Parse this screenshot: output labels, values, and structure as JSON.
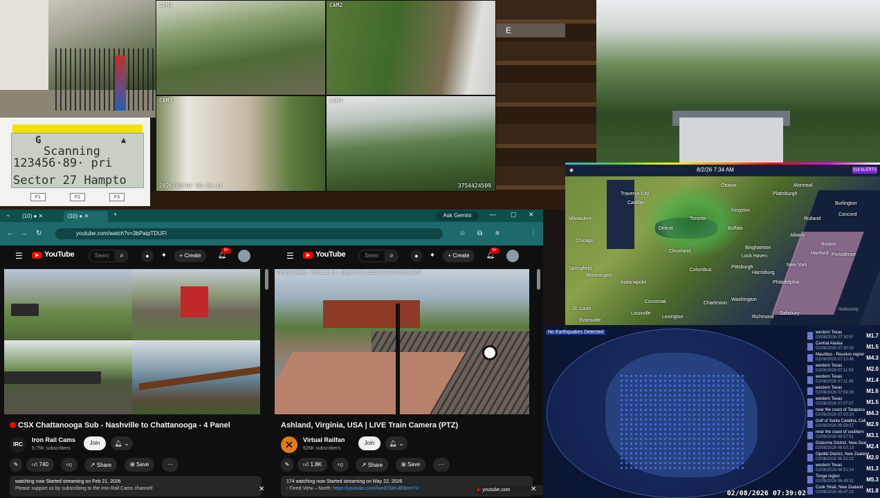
{
  "cameras": {
    "cam1_label": "CAM1",
    "cam2_label": "CAM2",
    "cam3_label": "CAM3",
    "cam4_label": "CAM4",
    "timestamp": "2026/08/02 06:36:11",
    "cam4_id": "3754424509"
  },
  "game": {
    "hud_letter": "E"
  },
  "scanner": {
    "line1_left": "G",
    "line1_right": "▲",
    "line2": "Scanning",
    "line3": "123456·89·  pri",
    "line4": "Sector 27 Hampto",
    "f1": "F1",
    "f2": "F2",
    "f3": "F3"
  },
  "browser": {
    "tab1": "(10) ●",
    "tab2": "(10) ●",
    "ask_gemini": "Ask Gemini",
    "url": "youtube.com/watch?v=3bPatpTDUFI",
    "new_tab": "+"
  },
  "youtube_left": {
    "logo": "YouTube",
    "search_placeholder": "Searc",
    "create": "Create",
    "badge": "9+",
    "title": "CSX Chattanooga Sub - Nashville to Chattanooga - 4 Panel",
    "channel": "Iron Rail Cams",
    "subscribers": "5.75K subscribers",
    "join": "Join",
    "likes": "740",
    "share": "Share",
    "save": "Save",
    "desc_line1": "watching now  Started streaming on Feb 21, 2026",
    "desc_line2": "Please support us by subscribing to the Iron Rail Cams channel!",
    "chav_text": "IRC"
  },
  "youtube_right": {
    "logo": "YouTube",
    "search_placeholder": "Searc",
    "create": "Create",
    "badge": "9+",
    "overlay": "Virtual Railfan - Ashland, Va - Depot PTZ  2026-08-02 07:36:20 EDT",
    "title": "Ashland, Virginia, USA | LIVE Train Camera (PTZ)",
    "channel": "Virtual Railfan",
    "subscribers": "526K subscribers",
    "join": "Join",
    "likes": "1.8K",
    "share": "Share",
    "save": "Save",
    "desc_line1": "174 watching now  Started streaming on May 22, 2026",
    "desc_line2_prefix": "- Fixed View – North: ",
    "desc_link": "https://youtube.com/live/DSkKdEBmrYU",
    "notif": "youtube.com"
  },
  "weather": {
    "time": "8/2/26 7:34 AM",
    "alerts": "318 ALERTS",
    "footer": "Reflectivity",
    "cities": [
      "Traverse City",
      "Ottawa",
      "Montreal",
      "Plattsburgh",
      "Cadillac",
      "Burlington",
      "Kingston",
      "Milwaukee",
      "Toronto",
      "Rutland",
      "Concord",
      "Chicago",
      "Detroit",
      "Buffalo",
      "Albany",
      "Boston",
      "Cleveland",
      "Binghamton",
      "Hartford",
      "Providence",
      "Springfield",
      "Indianapolis",
      "Columbus",
      "Pittsburgh",
      "Philadelphia",
      "New York",
      "Lock Haven",
      "Harrisburg",
      "Bloomington",
      "Cincinnati",
      "Washington",
      "Louisville",
      "Lexington",
      "Charleston",
      "St. Louis",
      "Evansville",
      "Richmond",
      "Salisbury"
    ]
  },
  "earthquakes": {
    "title": "No Earthquakes Detected",
    "time": "02/08/2026 07:39:02",
    "list": [
      {
        "place": "western Texas",
        "date": "02/08/2026 07:30:57",
        "mag": "M1.7"
      },
      {
        "place": "Central Alaska",
        "date": "02/08/2026 07:30:33",
        "mag": "M1.5"
      },
      {
        "place": "Mauritius - Reunion region",
        "date": "02/08/2026 07:12:46",
        "mag": "M4.3"
      },
      {
        "place": "western Texas",
        "date": "02/08/2026 07:11:59",
        "mag": "M2.0"
      },
      {
        "place": "western Texas",
        "date": "02/08/2026 07:11:49",
        "mag": "M1.4"
      },
      {
        "place": "western Texas",
        "date": "02/08/2026 07:09:26",
        "mag": "M1.6"
      },
      {
        "place": "western Texas",
        "date": "02/08/2026 07:07:07",
        "mag": "M1.5"
      },
      {
        "place": "near the coast of Tarapaca",
        "date": "02/08/2026 07:03:20",
        "mag": "M4.3"
      },
      {
        "place": "Gulf of Santa Catalina, Cali",
        "date": "02/08/2026 06:59:57",
        "mag": "M2.9"
      },
      {
        "place": "near the coast of southern",
        "date": "02/08/2026 06:57:51",
        "mag": "M3.1"
      },
      {
        "place": "Gisborne District, New Zeal",
        "date": "02/08/2026 06:53:13",
        "mag": "M2.4"
      },
      {
        "place": "Opotiki District, New Zealand",
        "date": "02/08/2026 06:52:23",
        "mag": "M2.0"
      },
      {
        "place": "western Texas",
        "date": "02/08/2026 06:51:14",
        "mag": "M1.3"
      },
      {
        "place": "Tonga region",
        "date": "02/08/2026 06:49:31",
        "mag": "M5.3"
      },
      {
        "place": "Cook Strait, New Zealand",
        "date": "02/08/2026 06:47:23",
        "mag": "M1.8"
      }
    ]
  }
}
